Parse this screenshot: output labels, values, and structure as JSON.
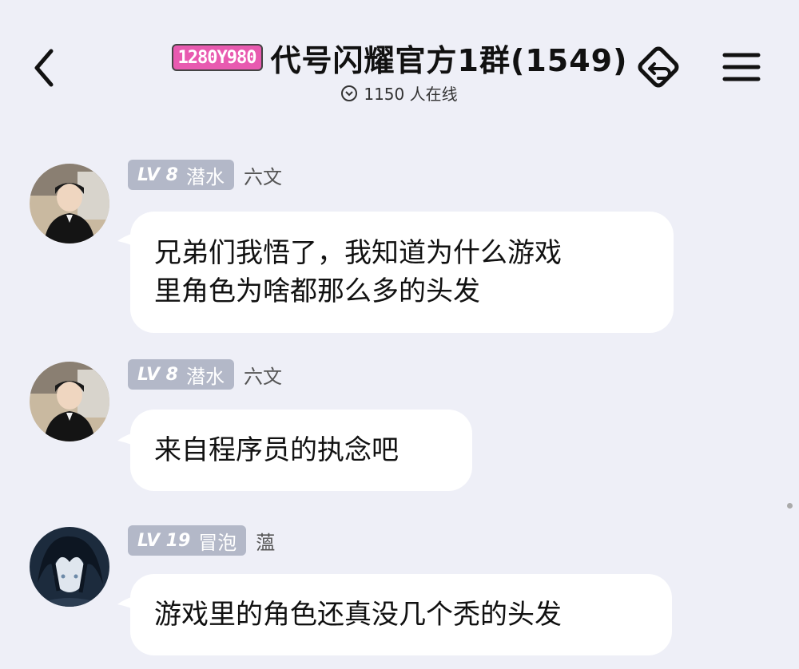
{
  "header": {
    "logo_text": "1280Y980",
    "title": "代号闪耀官方1群(1549)",
    "online": "1150 人在线"
  },
  "messages": [
    {
      "level": "LV 8",
      "title_tag": "潜水",
      "nickname": "六文",
      "text_lines": [
        "兄弟们我悟了，我知道为什么游戏",
        "里角色为啥都那么多的头发"
      ]
    },
    {
      "level": "LV 8",
      "title_tag": "潜水",
      "nickname": "六文",
      "text_lines": [
        "来自程序员的执念吧"
      ]
    },
    {
      "level": "LV 19",
      "title_tag": "冒泡",
      "nickname": "薀",
      "text_lines": [
        "游戏里的角色还真没几个秃的头发"
      ]
    }
  ],
  "icons": {
    "back": "chevron-left-icon",
    "transfer": "transfer-icon",
    "menu": "menu-icon"
  },
  "colors": {
    "background": "#eeeff7",
    "bubble": "#ffffff",
    "level_tag": "#b3b8c8"
  }
}
